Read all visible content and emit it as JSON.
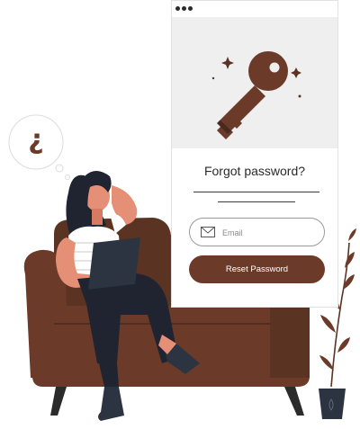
{
  "form": {
    "title": "Forgot password?",
    "email_placeholder": "Email",
    "reset_label": "Reset Password"
  },
  "thought_bubble": {
    "symbol": "¿"
  },
  "icons": {
    "key": "key-icon",
    "mail": "mail-icon",
    "sparkle": "sparkle-icon"
  },
  "colors": {
    "brand_brown": "#6b3a29",
    "dark_brown": "#4a2a1e",
    "panel_hero": "#efefef",
    "navy": "#2b3440"
  }
}
